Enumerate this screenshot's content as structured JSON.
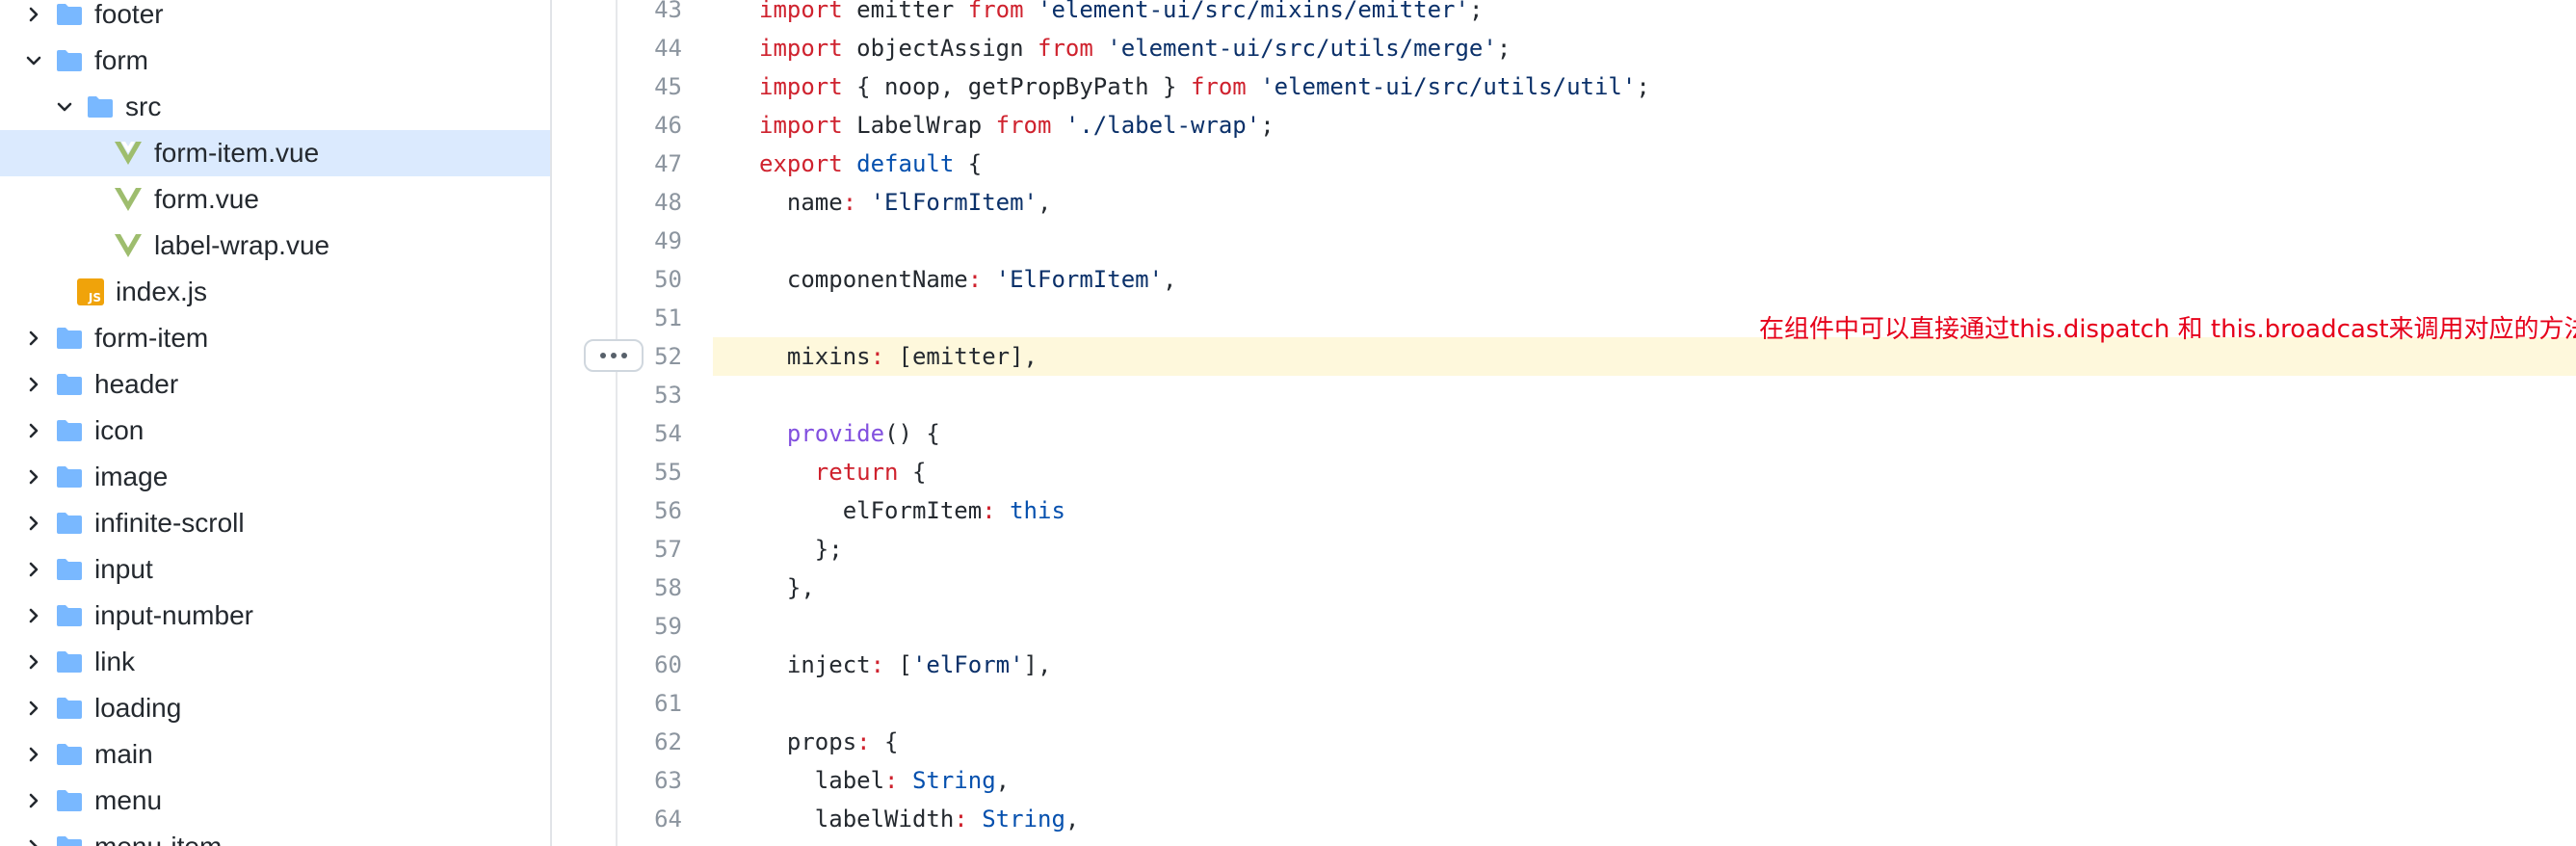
{
  "sidebar": {
    "items": [
      {
        "label": "footer",
        "kind": "folder",
        "expanded": false
      },
      {
        "label": "form",
        "kind": "folder",
        "expanded": true
      },
      {
        "label": "src",
        "kind": "folder",
        "expanded": true
      },
      {
        "label": "form-item.vue",
        "kind": "vue-file",
        "selected": true
      },
      {
        "label": "form.vue",
        "kind": "vue-file"
      },
      {
        "label": "label-wrap.vue",
        "kind": "vue-file"
      },
      {
        "label": "index.js",
        "kind": "js-file",
        "badge": "JS"
      },
      {
        "label": "form-item",
        "kind": "folder",
        "expanded": false
      },
      {
        "label": "header",
        "kind": "folder",
        "expanded": false
      },
      {
        "label": "icon",
        "kind": "folder",
        "expanded": false
      },
      {
        "label": "image",
        "kind": "folder",
        "expanded": false
      },
      {
        "label": "infinite-scroll",
        "kind": "folder",
        "expanded": false
      },
      {
        "label": "input",
        "kind": "folder",
        "expanded": false
      },
      {
        "label": "input-number",
        "kind": "folder",
        "expanded": false
      },
      {
        "label": "link",
        "kind": "folder",
        "expanded": false
      },
      {
        "label": "loading",
        "kind": "folder",
        "expanded": false
      },
      {
        "label": "main",
        "kind": "folder",
        "expanded": false
      },
      {
        "label": "menu",
        "kind": "folder",
        "expanded": false
      },
      {
        "label": "menu-item",
        "kind": "folder",
        "expanded": false
      }
    ]
  },
  "editor": {
    "highlighted_line": 52,
    "annotation": "在组件中可以直接通过this.dispatch 和 this.broadcast来调用对应的方法",
    "lines": [
      {
        "n": "43",
        "tokens": [
          [
            "kw",
            "import"
          ],
          [
            "p",
            " emitter "
          ],
          [
            "kw",
            "from"
          ],
          [
            "p",
            " "
          ],
          [
            "str",
            "'element-ui/src/mixins/emitter'"
          ],
          [
            "p",
            ";"
          ]
        ]
      },
      {
        "n": "44",
        "tokens": [
          [
            "kw",
            "import"
          ],
          [
            "p",
            " objectAssign "
          ],
          [
            "kw",
            "from"
          ],
          [
            "p",
            " "
          ],
          [
            "str",
            "'element-ui/src/utils/merge'"
          ],
          [
            "p",
            ";"
          ]
        ]
      },
      {
        "n": "45",
        "tokens": [
          [
            "kw",
            "import"
          ],
          [
            "p",
            " { noop, getPropByPath } "
          ],
          [
            "kw",
            "from"
          ],
          [
            "p",
            " "
          ],
          [
            "str",
            "'element-ui/src/utils/util'"
          ],
          [
            "p",
            ";"
          ]
        ]
      },
      {
        "n": "46",
        "tokens": [
          [
            "kw",
            "import"
          ],
          [
            "p",
            " LabelWrap "
          ],
          [
            "kw",
            "from"
          ],
          [
            "p",
            " "
          ],
          [
            "str",
            "'./label-wrap'"
          ],
          [
            "p",
            ";"
          ]
        ]
      },
      {
        "n": "47",
        "tokens": [
          [
            "kw",
            "export"
          ],
          [
            "p",
            " "
          ],
          [
            "con",
            "default"
          ],
          [
            "p",
            " {"
          ]
        ]
      },
      {
        "n": "48",
        "tokens": [
          [
            "p",
            "  name"
          ],
          [
            "kw",
            ":"
          ],
          [
            "p",
            " "
          ],
          [
            "str",
            "'ElFormItem'"
          ],
          [
            "p",
            ","
          ]
        ]
      },
      {
        "n": "49",
        "tokens": []
      },
      {
        "n": "50",
        "tokens": [
          [
            "p",
            "  componentName"
          ],
          [
            "kw",
            ":"
          ],
          [
            "p",
            " "
          ],
          [
            "str",
            "'ElFormItem'"
          ],
          [
            "p",
            ","
          ]
        ]
      },
      {
        "n": "51",
        "tokens": []
      },
      {
        "n": "52",
        "tokens": [
          [
            "p",
            "  mixins"
          ],
          [
            "kw",
            ":"
          ],
          [
            "p",
            " [emitter],"
          ]
        ]
      },
      {
        "n": "53",
        "tokens": []
      },
      {
        "n": "54",
        "tokens": [
          [
            "p",
            "  "
          ],
          [
            "fn",
            "provide"
          ],
          [
            "p",
            "() {"
          ]
        ]
      },
      {
        "n": "55",
        "tokens": [
          [
            "p",
            "    "
          ],
          [
            "kw",
            "return"
          ],
          [
            "p",
            " {"
          ]
        ]
      },
      {
        "n": "56",
        "tokens": [
          [
            "p",
            "      elFormItem"
          ],
          [
            "kw",
            ":"
          ],
          [
            "p",
            " "
          ],
          [
            "con",
            "this"
          ]
        ]
      },
      {
        "n": "57",
        "tokens": [
          [
            "p",
            "    };"
          ]
        ]
      },
      {
        "n": "58",
        "tokens": [
          [
            "p",
            "  },"
          ]
        ]
      },
      {
        "n": "59",
        "tokens": []
      },
      {
        "n": "60",
        "tokens": [
          [
            "p",
            "  inject"
          ],
          [
            "kw",
            ":"
          ],
          [
            "p",
            " ["
          ],
          [
            "str",
            "'elForm'"
          ],
          [
            "p",
            "],"
          ]
        ]
      },
      {
        "n": "61",
        "tokens": []
      },
      {
        "n": "62",
        "tokens": [
          [
            "p",
            "  props"
          ],
          [
            "kw",
            ":"
          ],
          [
            "p",
            " {"
          ]
        ]
      },
      {
        "n": "63",
        "tokens": [
          [
            "p",
            "    label"
          ],
          [
            "kw",
            ":"
          ],
          [
            "p",
            " "
          ],
          [
            "con",
            "String"
          ],
          [
            "p",
            ","
          ]
        ]
      },
      {
        "n": "64",
        "tokens": [
          [
            "p",
            "    labelWidth"
          ],
          [
            "kw",
            ":"
          ],
          [
            "p",
            " "
          ],
          [
            "con",
            "String"
          ],
          [
            "p",
            ","
          ]
        ]
      }
    ]
  },
  "colors": {
    "folder": "#79b8ff",
    "vue": "#41b883",
    "vue_dark": "#9ebd6e",
    "js_badge": "#f0a30a",
    "selected_row": "#dbeafe",
    "highlight_line": "#fef8dc",
    "annotation": "#e6001a"
  }
}
